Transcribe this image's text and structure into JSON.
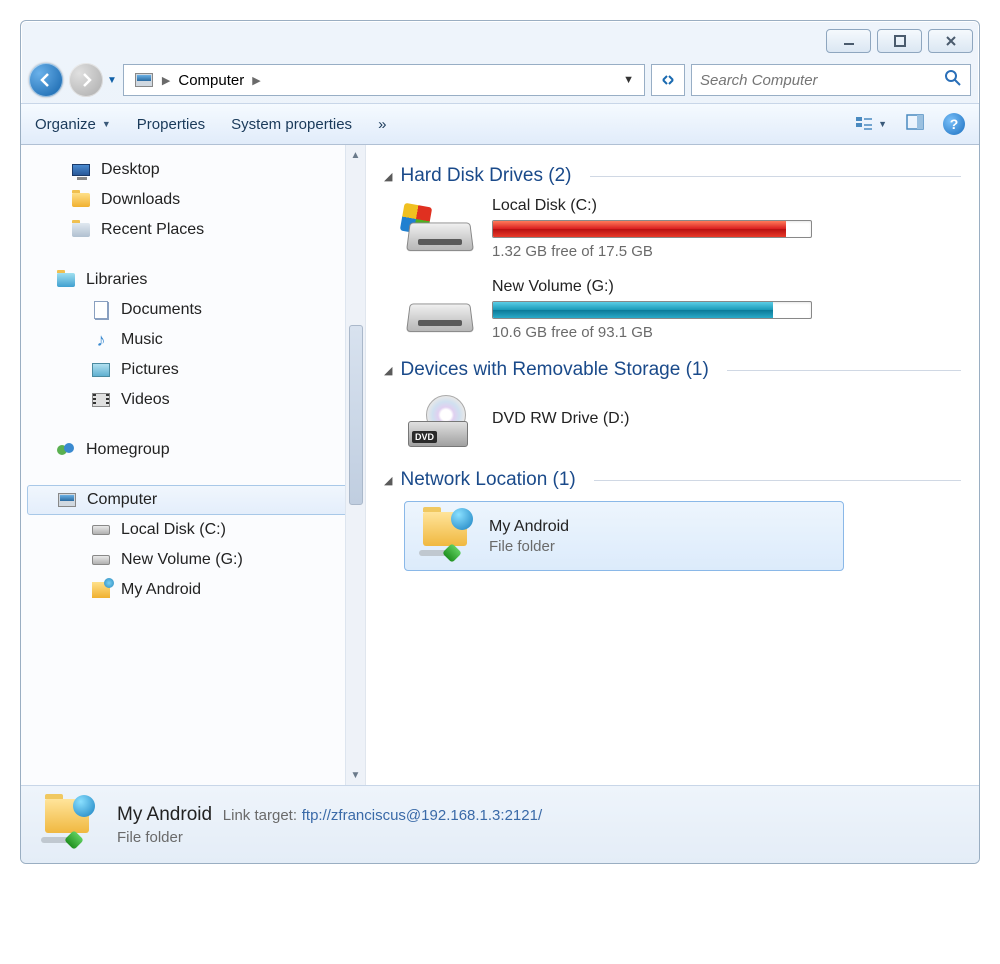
{
  "breadcrumb": {
    "location": "Computer"
  },
  "search": {
    "placeholder": "Search Computer"
  },
  "toolbar": {
    "organize": "Organize",
    "properties": "Properties",
    "system_properties": "System properties",
    "overflow": "»"
  },
  "sidebar": {
    "favorites": [
      {
        "label": "Desktop",
        "icon": "desktop"
      },
      {
        "label": "Downloads",
        "icon": "folder"
      },
      {
        "label": "Recent Places",
        "icon": "recent"
      }
    ],
    "libraries_label": "Libraries",
    "libraries": [
      {
        "label": "Documents",
        "icon": "doc"
      },
      {
        "label": "Music",
        "icon": "music"
      },
      {
        "label": "Pictures",
        "icon": "pic"
      },
      {
        "label": "Videos",
        "icon": "vid"
      }
    ],
    "homegroup_label": "Homegroup",
    "computer_label": "Computer",
    "computer_children": [
      {
        "label": "Local Disk (C:)",
        "icon": "hdd"
      },
      {
        "label": "New Volume (G:)",
        "icon": "hdd"
      },
      {
        "label": "My Android",
        "icon": "android"
      }
    ]
  },
  "content": {
    "hdd_section": "Hard Disk Drives (2)",
    "drives": [
      {
        "name": "Local Disk (C:)",
        "free": "1.32 GB free of 17.5 GB",
        "fill_pct": 92,
        "color": "red",
        "os": true
      },
      {
        "name": "New Volume (G:)",
        "free": "10.6 GB free of 93.1 GB",
        "fill_pct": 88,
        "color": "teal",
        "os": false
      }
    ],
    "removable_section": "Devices with Removable Storage (1)",
    "dvd_label": "DVD RW Drive (D:)",
    "dvd_badge": "DVD",
    "network_section": "Network Location (1)",
    "network_item": {
      "name": "My Android",
      "type": "File folder"
    }
  },
  "details": {
    "name": "My Android",
    "link_key": "Link target:",
    "link_val": "ftp://zfranciscus@192.168.1.3:2121/",
    "type": "File folder"
  }
}
